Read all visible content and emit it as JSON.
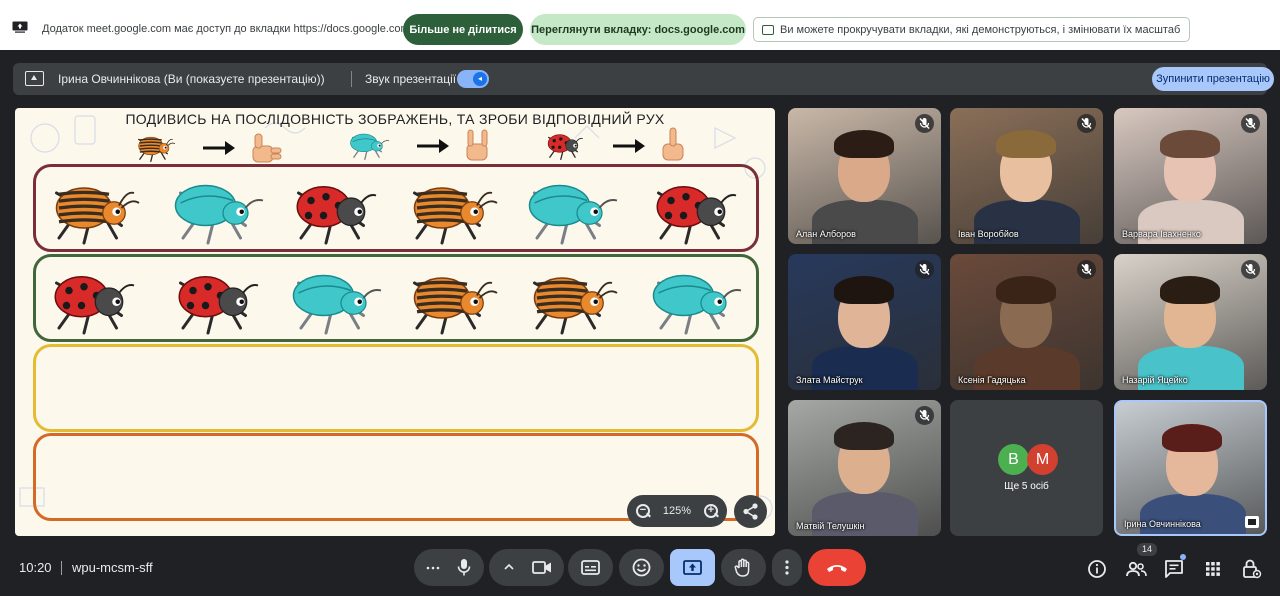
{
  "sharebar": {
    "message": "Додаток meet.google.com має доступ до вкладки https://docs.google.com",
    "stop_sharing": "Більше не ділитися",
    "view_tab": "Переглянути вкладку: docs.google.com",
    "hint": "Ви можете прокручувати вкладки, які демонструються, і змінювати їх масштаб"
  },
  "presentbar": {
    "presenter": "Ірина Овчиннікова (Ви (показуєте презентацію))",
    "sound_label": "Звук презентації",
    "sound_on": true,
    "stop_presenting": "Зупинити презентацію"
  },
  "slide": {
    "title": "ПОДИВИСЬ НА ПОСЛІДОВНІСТЬ ЗОБРАЖЕНЬ, ТА ЗРОБИ ВІДПОВІДНИЙ РУХ",
    "legend": [
      {
        "bug": "colorado-beetle",
        "gesture": "thumbs-up"
      },
      {
        "bug": "teal-beetle",
        "gesture": "rock-hand"
      },
      {
        "bug": "ladybug",
        "gesture": "index-up"
      }
    ],
    "rows": [
      [
        "colorado-beetle",
        "teal-beetle",
        "ladybug",
        "colorado-beetle",
        "teal-beetle",
        "ladybug"
      ],
      [
        "ladybug",
        "ladybug",
        "teal-beetle",
        "colorado-beetle",
        "colorado-beetle",
        "teal-beetle"
      ],
      [],
      []
    ],
    "zoom": "125%",
    "colors": {
      "colorado": "#e8892e",
      "colorado_stripe": "#3a2c1e",
      "teal": "#3fc7c9",
      "ladybug": "#d92a2a",
      "ladybug_head": "#4a4a4a"
    }
  },
  "participants": [
    {
      "name": "Алан Алборов",
      "muted": true,
      "bg": "#c9b8a8",
      "face": "#d9a98a",
      "hair": "#2b1d16",
      "shirt": "#4a4a4a"
    },
    {
      "name": "Іван Воробйов",
      "muted": true,
      "bg": "#8a6f58",
      "face": "#e8c0a0",
      "hair": "#8a6a3a",
      "shirt": "#283244"
    },
    {
      "name": "Варвара Івахненко",
      "muted": true,
      "bg": "#d8c8c0",
      "face": "#e7c3b3",
      "hair": "#6b4a3a",
      "shirt": "#d9c9c0"
    },
    {
      "name": "Злата Майструк",
      "muted": true,
      "bg": "#27395c",
      "face": "#e0b496",
      "hair": "#1e1410",
      "shirt": "#1a2c4f"
    },
    {
      "name": "Ксенія Гадяцька",
      "muted": true,
      "bg": "#6a4a3a",
      "face": "#8a6a50",
      "hair": "#3a2418",
      "shirt": "#5a3a2a"
    },
    {
      "name": "Назарій Яцейко",
      "muted": true,
      "bg": "#d9d2c9",
      "face": "#e2b692",
      "hair": "#2a1d14",
      "shirt": "#4ac2c9"
    },
    {
      "name": "Матвій Телушкін",
      "muted": true,
      "bg": "#a5a8a5",
      "face": "#dcb08f",
      "hair": "#2c2420",
      "shirt": "#5a5a6a"
    },
    {
      "name": "Ірина Овчиннікова",
      "muted": false,
      "bg": "#c7cdd2",
      "face": "#e5b89c",
      "hair": "#5a1e1a",
      "shirt": "#3a4f7a"
    }
  ],
  "others": {
    "label": "Ще 5 осіб",
    "avatars": [
      {
        "letter": "В",
        "color": "#4caf50"
      },
      {
        "letter": "М",
        "color": "#d2402f"
      }
    ]
  },
  "bottombar": {
    "time": "10:20",
    "meeting_code": "wpu-mcsm-sff",
    "people_count": "14"
  }
}
